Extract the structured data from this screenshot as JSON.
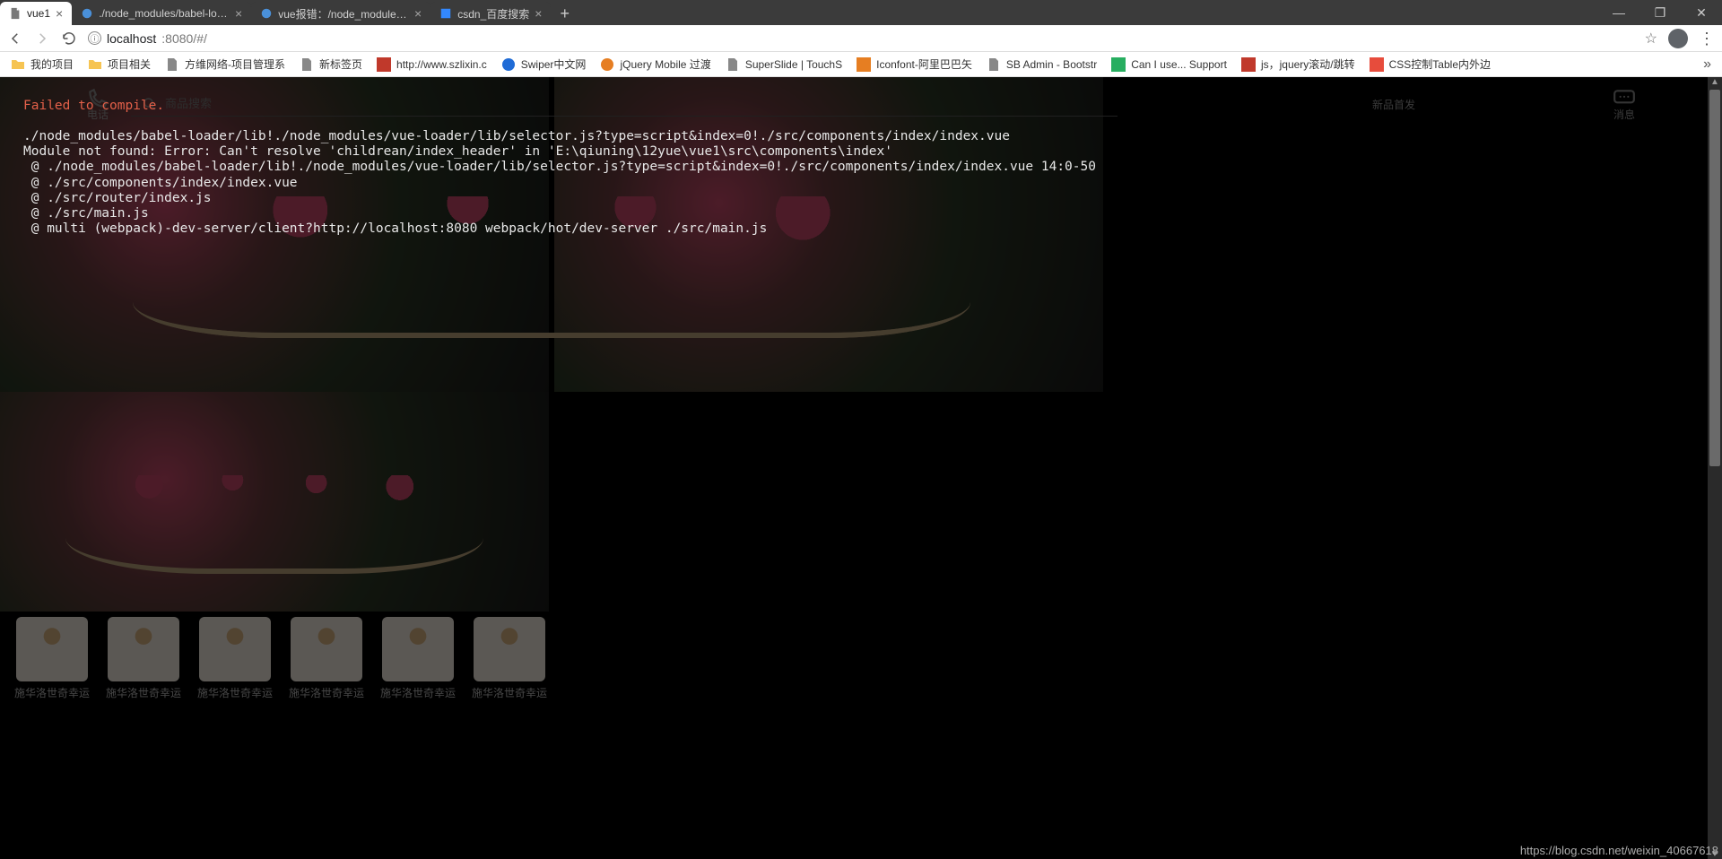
{
  "tabs": [
    {
      "title": "vue1",
      "active": true
    },
    {
      "title": "./node_modules/babel-loader/",
      "active": false
    },
    {
      "title": "vue报错：/node_modules/bab",
      "active": false
    },
    {
      "title": "csdn_百度搜索",
      "active": false
    }
  ],
  "window_controls": {
    "minimize": "—",
    "maximize": "❐",
    "close": "✕"
  },
  "nav": {
    "back": "←",
    "forward": "→",
    "reload": "⟳"
  },
  "url": {
    "info_icon": "ⓘ",
    "host": "localhost",
    "port_path": ":8080/#/"
  },
  "toolbar_right": {
    "star": "☆",
    "kebab": "⋮"
  },
  "bookmarks": [
    {
      "icon": "folder",
      "label": "我的项目"
    },
    {
      "icon": "folder",
      "label": "项目相关"
    },
    {
      "icon": "file",
      "label": "方维网络-项目管理系"
    },
    {
      "icon": "file",
      "label": "新标签页"
    },
    {
      "icon": "red",
      "label": "http://www.szlixin.c"
    },
    {
      "icon": "blue",
      "label": "Swiper中文网"
    },
    {
      "icon": "orange",
      "label": "jQuery Mobile 过渡"
    },
    {
      "icon": "file",
      "label": "SuperSlide | TouchS"
    },
    {
      "icon": "orange",
      "label": "Iconfont-阿里巴巴矢"
    },
    {
      "icon": "file",
      "label": "SB Admin - Bootstr"
    },
    {
      "icon": "green",
      "label": "Can I use... Support"
    },
    {
      "icon": "red",
      "label": "js，jquery滚动/跳转"
    },
    {
      "icon": "orange",
      "label": "CSS控制Table内外边"
    }
  ],
  "bookmarks_more": "»",
  "page_header": {
    "phone_label": "电话",
    "search_placeholder": "商品搜索",
    "right_promo": "新品首发",
    "msg_label": "消息"
  },
  "thumbs": [
    {
      "label": "施华洛世奇幸运"
    },
    {
      "label": "施华洛世奇幸运"
    },
    {
      "label": "施华洛世奇幸运"
    },
    {
      "label": "施华洛世奇幸运"
    },
    {
      "label": "施华洛世奇幸运"
    },
    {
      "label": "施华洛世奇幸运"
    }
  ],
  "error": {
    "title": "Failed to compile.",
    "body": "./node_modules/babel-loader/lib!./node_modules/vue-loader/lib/selector.js?type=script&index=0!./src/components/index/index.vue\nModule not found: Error: Can't resolve 'childrean/index_header' in 'E:\\qiuning\\12yue\\vue1\\src\\components\\index'\n @ ./node_modules/babel-loader/lib!./node_modules/vue-loader/lib/selector.js?type=script&index=0!./src/components/index/index.vue 14:0-50\n @ ./src/components/index/index.vue\n @ ./src/router/index.js\n @ ./src/main.js\n @ multi (webpack)-dev-server/client?http://localhost:8080 webpack/hot/dev-server ./src/main.js"
  },
  "watermark": "https://blog.csdn.net/weixin_40667618"
}
